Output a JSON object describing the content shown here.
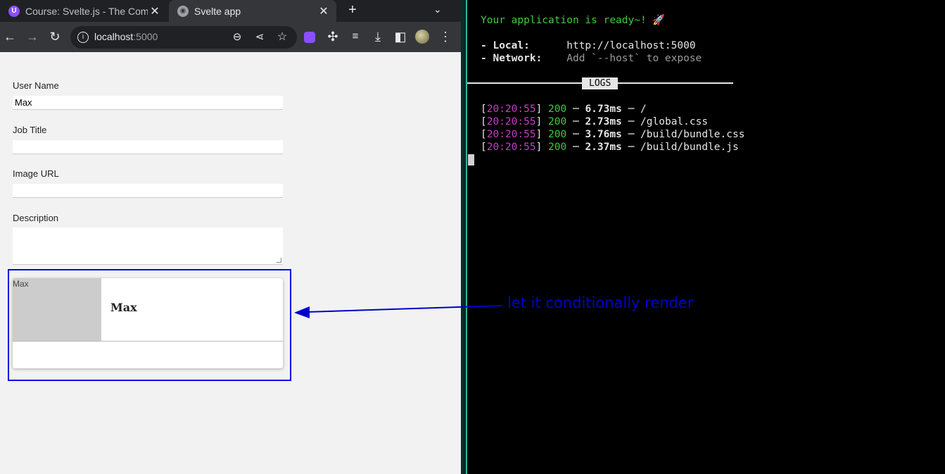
{
  "browser": {
    "tabs": [
      {
        "title": "Course: Svelte.js - The Complete Guide",
        "favicon": "udemy-icon",
        "active": false
      },
      {
        "title": "Svelte app",
        "favicon": "globe-icon",
        "active": true
      }
    ],
    "url_host": "localhost",
    "url_port": ":5000"
  },
  "form": {
    "user_name_label": "User Name",
    "user_name_value": "Max",
    "job_title_label": "Job Title",
    "job_title_value": "",
    "image_url_label": "Image URL",
    "image_url_value": "",
    "description_label": "Description",
    "description_value": ""
  },
  "card": {
    "image_alt": "Max",
    "name": "Max"
  },
  "annotation": {
    "text": "let it conditionally render",
    "color": "#0000cc"
  },
  "terminal": {
    "ready": "Your application is ready~! 🚀",
    "local_label": "- Local:",
    "local_url": "http://localhost:5000",
    "network_label": "- Network:",
    "network_value": "Add `--host` to expose",
    "logs_label": "LOGS",
    "logs": [
      {
        "time": "20:20:55",
        "status": "200",
        "duration": "6.73ms",
        "path": "/"
      },
      {
        "time": "20:20:55",
        "status": "200",
        "duration": "2.73ms",
        "path": "/global.css"
      },
      {
        "time": "20:20:55",
        "status": "200",
        "duration": "3.76ms",
        "path": "/build/bundle.css"
      },
      {
        "time": "20:20:55",
        "status": "200",
        "duration": "2.37ms",
        "path": "/build/bundle.js"
      }
    ]
  }
}
